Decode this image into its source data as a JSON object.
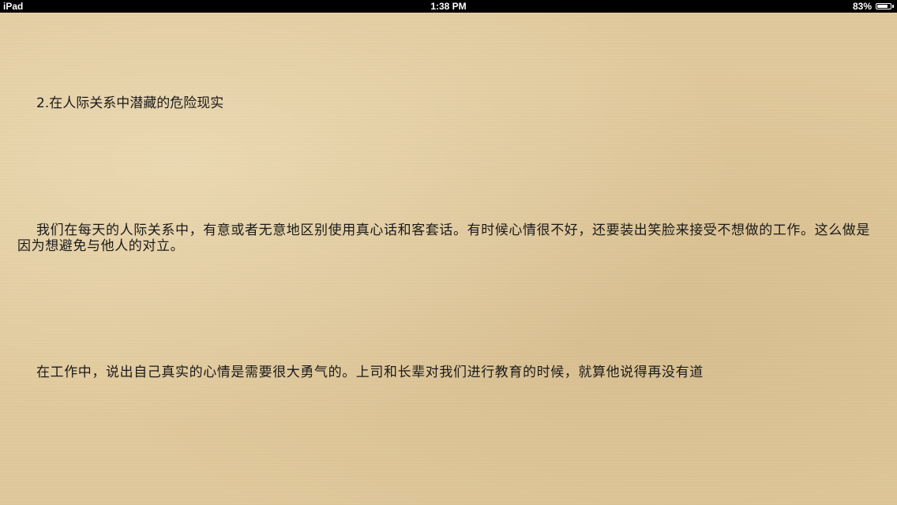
{
  "status_bar": {
    "device": "iPad",
    "time": "1:38 PM",
    "battery_percent": "83%",
    "battery_level": 0.83
  },
  "book": {
    "heading": "2.在人际关系中潜藏的危险现实",
    "paragraphs": [
      "我们在每天的人际关系中，有意或者无意地区别使用真心话和客套话。有时候心情很不好，还要装出笑脸来接受不想做的工作。这么做是因为想避免与他人的对立。",
      "在工作中，说出自己真实的心情是需要很大勇气的。上司和长辈对我们进行教育的时候，就算他说得再没有道"
    ]
  }
}
